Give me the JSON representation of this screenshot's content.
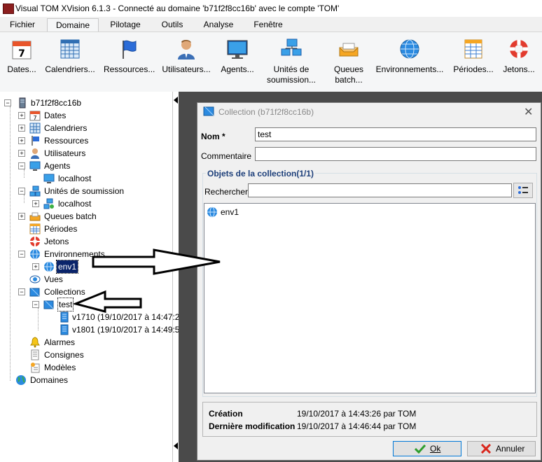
{
  "window": {
    "title": "Visual TOM XVision 6.1.3 - Connecté au domaine 'b71f2f8cc16b' avec le compte 'TOM'"
  },
  "menu": {
    "tabs": [
      "Fichier",
      "Domaine",
      "Pilotage",
      "Outils",
      "Analyse",
      "Fenêtre"
    ],
    "active": "Domaine"
  },
  "ribbon": {
    "items": [
      {
        "label": "Dates...",
        "icon": "calendar-7-icon"
      },
      {
        "label": "Calendriers...",
        "icon": "grid-calendar-icon"
      },
      {
        "label": "Ressources...",
        "icon": "flag-icon"
      },
      {
        "label": "Utilisateurs...",
        "icon": "user-icon"
      },
      {
        "label": "Agents...",
        "icon": "monitor-icon"
      },
      {
        "label": "Unités de\nsoumission...",
        "icon": "network-computers-icon"
      },
      {
        "label": "Queues\nbatch...",
        "icon": "queue-tray-icon"
      },
      {
        "label": "Environnements...",
        "icon": "globe-icon"
      },
      {
        "label": "Périodes...",
        "icon": "table-icon"
      },
      {
        "label": "Jetons...",
        "icon": "lifebuoy-icon"
      }
    ]
  },
  "tree": {
    "root": "b71f2f8cc16b",
    "nodes": {
      "dates": "Dates",
      "calendriers": "Calendriers",
      "ressources": "Ressources",
      "utilisateurs": "Utilisateurs",
      "agents": "Agents",
      "agents_localhost": "localhost",
      "unites": "Unités de soumission",
      "unites_localhost": "localhost",
      "queues": "Queues batch",
      "periodes": "Périodes",
      "jetons": "Jetons",
      "environnements": "Environnements",
      "env1": "env1",
      "vues": "Vues",
      "collections": "Collections",
      "test": "test",
      "v1710": "v1710 (19/10/2017 à 14:47:2",
      "v1801": "v1801 (19/10/2017 à 14:49:5",
      "alarmes": "Alarmes",
      "consignes": "Consignes",
      "modeles": "Modèles",
      "domaines": "Domaines"
    }
  },
  "dialog": {
    "title": "Collection (b71f2f8cc16b)",
    "nom_label": "Nom *",
    "nom_value": "test",
    "commentaire_label": "Commentaire",
    "commentaire_value": "",
    "group_label": "Objets de la collection(1/1)",
    "rechercher_label": "Rechercher",
    "rechercher_value": "",
    "list_items": [
      "env1"
    ],
    "creation_label": "Création",
    "creation_value": "19/10/2017 à 14:43:26 par TOM",
    "modif_label": "Dernière modification",
    "modif_value": "19/10/2017 à 14:46:44 par TOM",
    "ok_label": "Ok",
    "annuler_label": "Annuler"
  },
  "colors": {
    "selection": "#0a246a",
    "dark_area": "#4a4a4a",
    "group_title": "#1d3f7a"
  }
}
